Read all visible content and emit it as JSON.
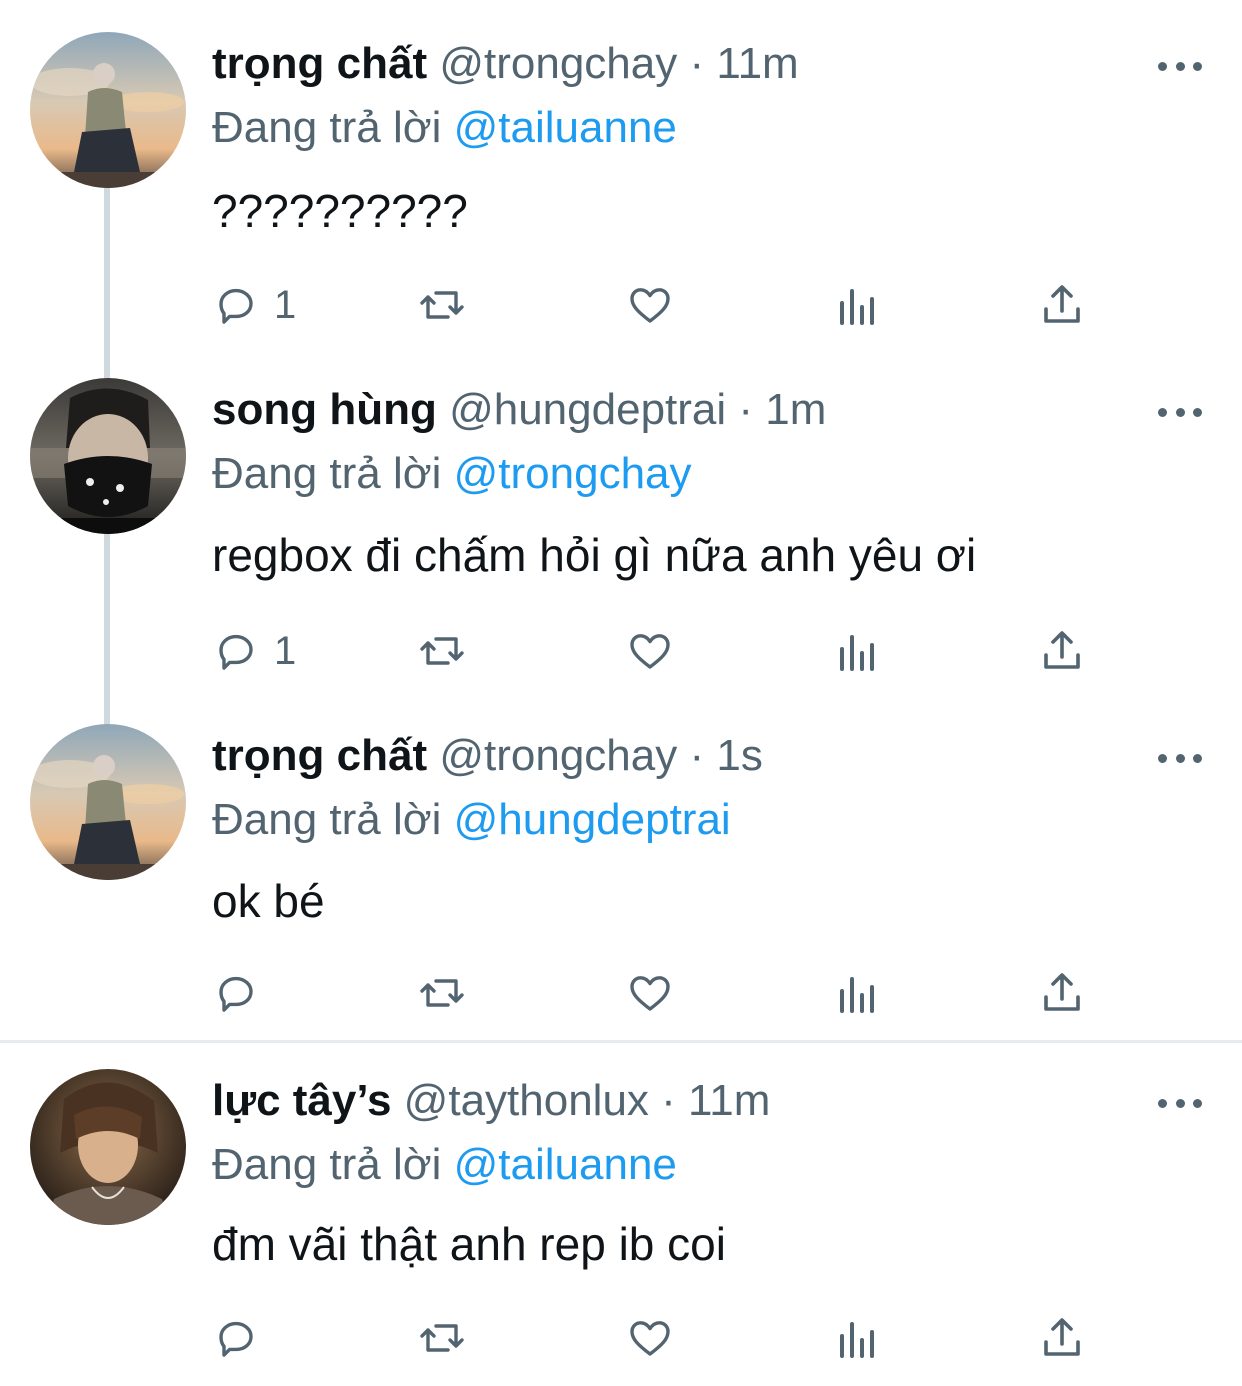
{
  "tweets": [
    {
      "name": "trọng chất",
      "handle": "@trongchay",
      "separator": " · ",
      "time": "11m",
      "replying_label": "Đang trả lời ",
      "replying_to": "@tailuanne",
      "text": "??????????",
      "reply_count": "1",
      "avatar": "sunset-photo"
    },
    {
      "name": "song hùng",
      "handle": "@hungdeptrai",
      "separator": " · ",
      "time": "1m",
      "replying_label": "Đang trả lời ",
      "replying_to": "@trongchay",
      "text": "regbox đi chấm hỏi gì nữa anh yêu ơi",
      "reply_count": "1",
      "avatar": "masked-face-photo"
    },
    {
      "name": "trọng chất",
      "handle": "@trongchay",
      "separator": " · ",
      "time": "1s",
      "replying_label": "Đang trả lời ",
      "replying_to": "@hungdeptrai",
      "text": "ok bé",
      "reply_count": "",
      "avatar": "sunset-photo"
    },
    {
      "name": "lực tây’s",
      "handle": "@taythonlux",
      "separator": " · ",
      "time": "11m",
      "replying_label": "Đang trả lời ",
      "replying_to": "@tailuanne",
      "text": "đm vãi thật anh rep ib coi",
      "reply_count": "",
      "avatar": "portrait-photo"
    }
  ],
  "icons": {
    "reply": "reply-icon",
    "retweet": "retweet-icon",
    "like": "like-icon",
    "views": "views-icon",
    "share": "share-icon",
    "more": "more-icon"
  },
  "colors": {
    "text": "#0f1419",
    "secondary": "#536471",
    "mention": "#1d9bf0",
    "thread_line": "#cfd9de"
  }
}
